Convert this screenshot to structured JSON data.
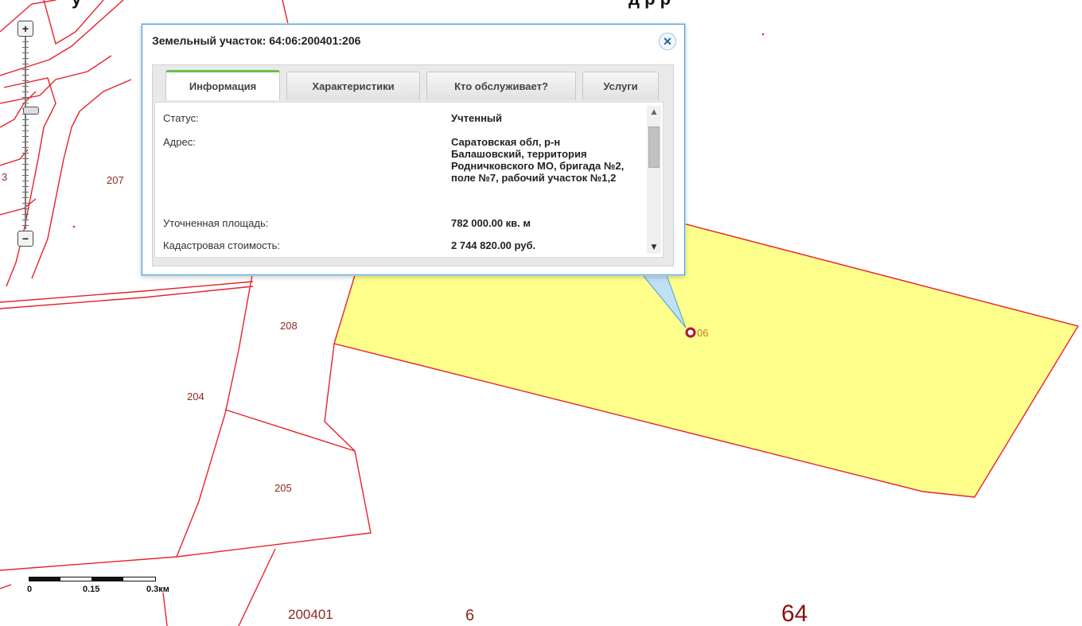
{
  "page": {
    "headline_left": "у",
    "headline_right": "д   р     р"
  },
  "popup": {
    "title": "Земельный участок: 64:06:200401:206",
    "close_icon": "close-icon",
    "tabs": [
      {
        "label": "Информация",
        "active": true
      },
      {
        "label": "Характеристики",
        "active": false
      },
      {
        "label": "Кто обслуживает?",
        "active": false
      },
      {
        "label": "Услуги",
        "active": false
      }
    ],
    "rows": [
      {
        "label": "Статус:",
        "value": "Учтенный"
      },
      {
        "label": "Адрес:",
        "value": "Саратовская обл, р-н Балашовский, территория Родничковского МО, бригада №2, поле №7, рабочий участок №1,2"
      },
      {
        "label": "Уточненная площадь:",
        "value": "782 000.00 кв. м"
      },
      {
        "label": "Кадастровая стоимость:",
        "value": "2 744 820.00 руб."
      }
    ]
  },
  "zoom": {
    "in_label": "+",
    "out_label": "−"
  },
  "scale": {
    "labels": [
      "0",
      "0.15",
      "0.3км"
    ]
  },
  "map": {
    "parcel_labels": [
      "207",
      "208",
      "204",
      "205",
      "06"
    ],
    "quarter_label": "200401",
    "district_label": "6",
    "region_label": "64",
    "left_edge_label": "3",
    "colors": {
      "parcel_outline": "#e8212b",
      "selected_fill": "#ffff8c",
      "label": "#8b2a22",
      "marker": "#b0123a",
      "popup_border": "#4f9fd3",
      "tab_active_accent": "#6cbf4a"
    }
  }
}
